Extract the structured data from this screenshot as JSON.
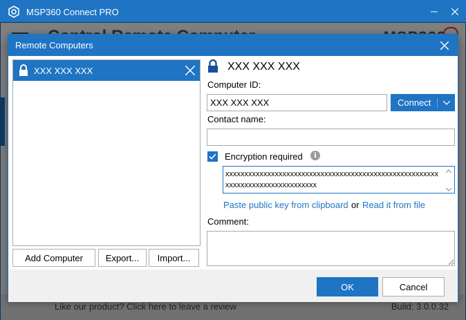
{
  "app": {
    "title": "MSP360 Connect PRO",
    "header_title": "Control Remote Computer",
    "brand": "MSP360",
    "review_link": "Like our product? Click here to leave a review",
    "build": "Build: 3.0.0.32"
  },
  "dialog": {
    "title": "Remote Computers",
    "list": {
      "items": [
        {
          "label": "XXX XXX XXX"
        }
      ]
    },
    "buttons": {
      "add_computer": "Add Computer",
      "export": "Export...",
      "import": "Import..."
    },
    "detail": {
      "title": "XXX XXX XXX",
      "computer_id_label": "Computer ID:",
      "computer_id_value": "XXX XXX XXX",
      "connect_label": "Connect",
      "contact_name_label": "Contact name:",
      "contact_name_value": "",
      "encryption_label": "Encryption required",
      "encryption_checked": true,
      "public_key": "xxxxxxxxxxxxxxxxxxxxxxxxxxxxxxxxxxxxxxxxxxxxxxxxxxxxxxxxxxxxxxxxxxxxxxxxxxxxxxxx",
      "paste_link": "Paste public key from clipboard",
      "or_text": "or",
      "read_link": "Read it from file",
      "comment_label": "Comment:",
      "comment_value": ""
    },
    "footer": {
      "ok": "OK",
      "cancel": "Cancel"
    }
  },
  "colors": {
    "accent": "#1f74c4",
    "link": "#1f74c4"
  },
  "icons": {
    "app_logo": "msp360-logo-icon",
    "lock": "lock-icon",
    "close": "close-icon",
    "info": "info-icon",
    "check": "checkmark-icon",
    "chevron": "chevron-down-icon"
  }
}
